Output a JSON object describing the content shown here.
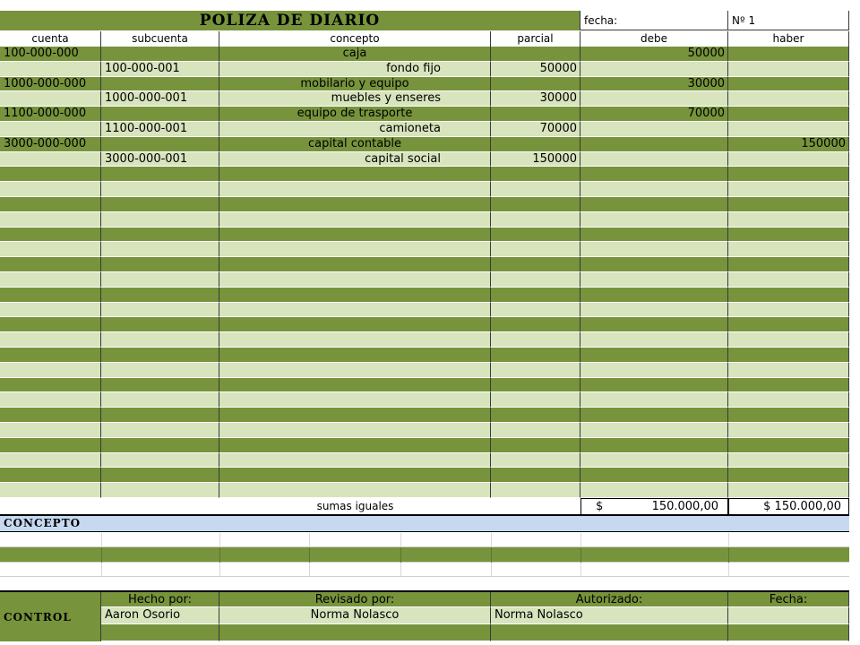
{
  "header": {
    "title": "POLIZA DE DIARIO",
    "fecha_label": "fecha:",
    "numero_label": "Nº 1"
  },
  "columns": [
    "cuenta",
    "subcuenta",
    "concepto",
    "parcial",
    "debe",
    "haber"
  ],
  "rows": [
    {
      "cuenta": "100-000-000",
      "subcuenta": "",
      "concepto": "caja",
      "parcial": "",
      "debe": "50000",
      "haber": ""
    },
    {
      "cuenta": "",
      "subcuenta": "100-000-001",
      "concepto": "fondo fijo",
      "parcial": "50000",
      "debe": "",
      "haber": ""
    },
    {
      "cuenta": "1000-000-000",
      "subcuenta": "",
      "concepto": "mobilario y equipo",
      "parcial": "",
      "debe": "30000",
      "haber": ""
    },
    {
      "cuenta": "",
      "subcuenta": "1000-000-001",
      "concepto": "muebles y enseres",
      "parcial": "30000",
      "debe": "",
      "haber": ""
    },
    {
      "cuenta": "1100-000-000",
      "subcuenta": "",
      "concepto": "equipo de trasporte",
      "parcial": "",
      "debe": "70000",
      "haber": ""
    },
    {
      "cuenta": "",
      "subcuenta": "1100-000-001",
      "concepto": "camioneta",
      "parcial": "70000",
      "debe": "",
      "haber": ""
    },
    {
      "cuenta": "3000-000-000",
      "subcuenta": "",
      "concepto": "capital contable",
      "parcial": "",
      "debe": "",
      "haber": "150000"
    },
    {
      "cuenta": "",
      "subcuenta": "3000-000-001",
      "concepto": "capital social",
      "parcial": "150000",
      "debe": "",
      "haber": ""
    }
  ],
  "totals": {
    "label": "sumas iguales",
    "currency": "$",
    "debe": "150.000,00",
    "haber": "$ 150.000,00"
  },
  "concepto_section": {
    "label": "CONCEPTO"
  },
  "control": {
    "label": "CONTROL",
    "hecho_label": "Hecho por:",
    "revisado_label": "Revisado por:",
    "autorizado_label": "Autorizado:",
    "fecha_label": "Fecha:",
    "hecho_value": "Aaron Osorio",
    "revisado_value": "Norma  Nolasco",
    "autorizado_value": "Norma Nolasco",
    "fecha_value": ""
  },
  "colors": {
    "dark_green": "#77933c",
    "light_green": "#d7e4bd",
    "light_blue": "#c6d9f1"
  }
}
